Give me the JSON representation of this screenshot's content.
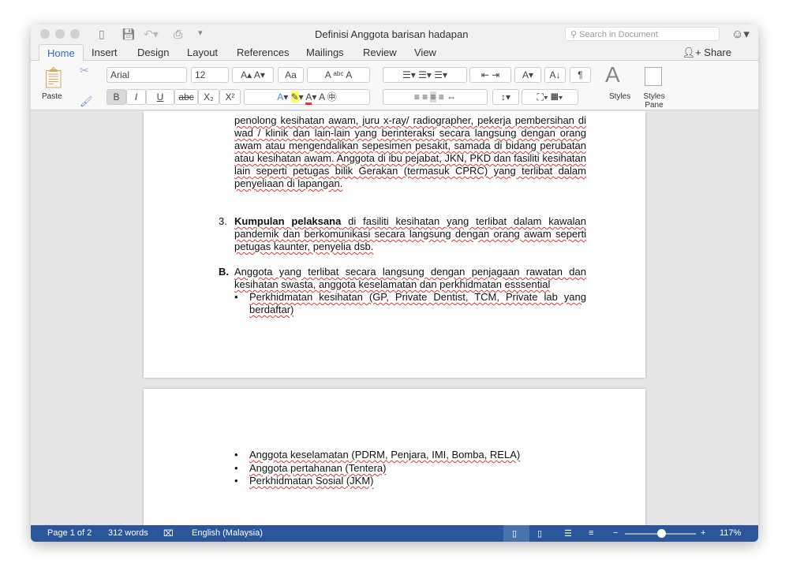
{
  "window": {
    "title": "Definisi Anggota barisan hadapan",
    "search_placeholder": "Search in Document"
  },
  "tabs": [
    "Home",
    "Insert",
    "Design",
    "Layout",
    "References",
    "Mailings",
    "Review",
    "View"
  ],
  "share_label": "Share",
  "ribbon": {
    "paste": "Paste",
    "font": "Arial",
    "size": "12",
    "bold": "B",
    "italic": "I",
    "underline": "U",
    "strike": "abc",
    "sub": "X₂",
    "sup": "X²",
    "styles": "Styles",
    "styles_pane": "Styles Pane",
    "pilcrow": "¶"
  },
  "document": {
    "para1": "penolong kesihatan awam, juru x-ray/ radiographer, pekerja pembersihan di wad / klinik dan lain-lain yang berinteraksi secara langsung dengan orang awam atau mengendalikan sepesimen pesakit, samada di bidang perubatan atau kesihatan awam. Anggota di ibu pejabat, JKN, PKD dan fasiliti kesihatan lain seperti petugas bilik Gerakan (termasuk CPRC) yang terlibat dalam penyeliaan di lapangan.",
    "item3_num": "3.",
    "item3_bold": "Kumpulan pelaksana",
    "item3_text": " di fasiliti kesihatan yang terlibat dalam kawalan pandemik dan berkomunikasi secara langsung dengan orang awam seperti petugas kaunter, penyelia dsb.",
    "itemB_num": "B.",
    "itemB_text": "Anggota yang terlibat secara langsung dengan penjagaan rawatan dan kesihatan swasta, anggota keselamatan dan perkhidmatan esssential",
    "bullets_p1": [
      "Perkhidmatan kesihatan (GP, Private Dentist, TCM, Private lab yang berdaftar)"
    ],
    "bullets_p2": [
      "Anggota keselamatan (PDRM, Penjara, IMI, Bomba, RELA)",
      "Anggota pertahanan (Tentera)",
      "Perkhidmatan Sosial (JKM)"
    ]
  },
  "status": {
    "page": "Page 1 of 2",
    "words": "312 words",
    "language": "English (Malaysia)",
    "zoom": "117%",
    "zoom_level_percent": 117
  },
  "colors": {
    "statusbar": "#2b579a",
    "accent": "#2b6ad1"
  }
}
